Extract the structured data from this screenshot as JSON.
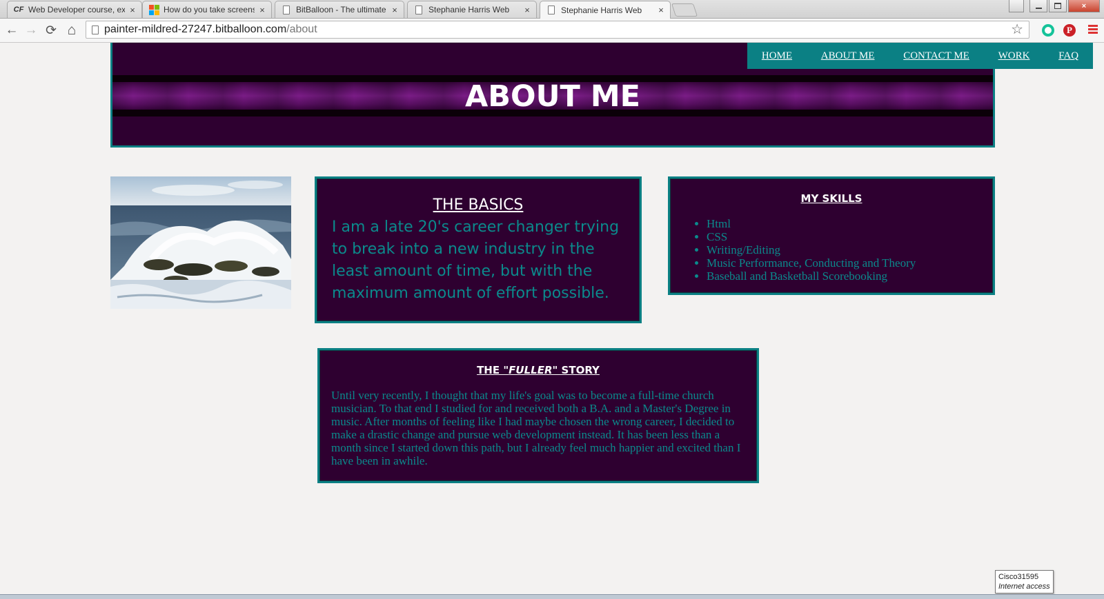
{
  "browser": {
    "tabs": [
      {
        "title": "Web Developer course, ex",
        "icon": "cf-icon"
      },
      {
        "title": "How do you take screensh",
        "icon": "microsoft-icon"
      },
      {
        "title": "BitBalloon - The ultimate",
        "icon": "page-icon"
      },
      {
        "title": "Stephanie Harris Web",
        "icon": "page-icon"
      },
      {
        "title": "Stephanie Harris Web",
        "icon": "page-icon"
      }
    ],
    "active_tab": 4,
    "close_glyph": "×",
    "back_glyph": "←",
    "forward_glyph": "→",
    "reload_glyph": "⟳",
    "home_glyph": "⌂",
    "star_glyph": "☆",
    "cf_label": "CF",
    "pinterest_label": "P",
    "url": {
      "host": "painter-mildred-27247.bitballoon.com",
      "path": "/about"
    }
  },
  "site": {
    "nav": [
      "HOME",
      "ABOUT ME",
      "CONTACT ME",
      "WORK",
      "FAQ"
    ],
    "title": "ABOUT ME",
    "basics": {
      "heading": "THE BASICS",
      "text": "I am a late 20's career changer trying to break into a new industry in the least amount of time, but with the maximum amount of effort possible."
    },
    "skills": {
      "heading": "MY SKILLS",
      "items": [
        "Html",
        "CSS",
        "Writing/Editing",
        "Music Performance, Conducting and Theory",
        "Baseball and Basketball Scorebooking"
      ]
    },
    "story": {
      "heading_pre": "THE \"",
      "heading_em": "FULLER",
      "heading_post": "\" STORY",
      "text": "Until very recently, I thought that my life's goal was to become a full-time church musician. To that end I studied for and received both a B.A. and a Master's Degree in music. After months of feeling like I had maybe chosen the wrong career, I decided to make a drastic change and pursue web development instead. It has been less than a month since I started down this path, but I already feel much happier and excited than I have been in awhile."
    },
    "colors": {
      "purple": "#2e0030",
      "teal": "#0b8084",
      "text_teal": "#0b8a8c"
    }
  },
  "tooltip": {
    "title": "Cisco31595",
    "subtitle": "Internet access"
  }
}
